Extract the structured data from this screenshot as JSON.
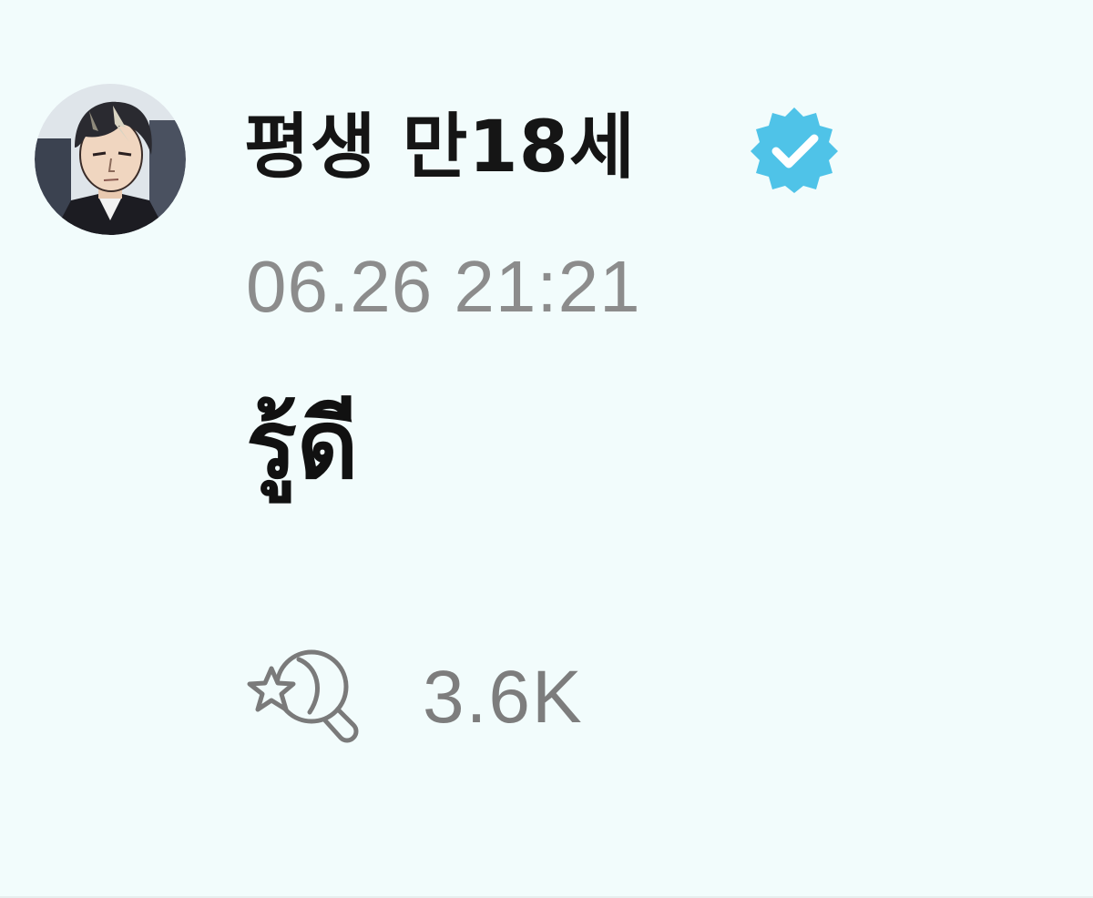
{
  "post": {
    "author": {
      "name": "평생 만18세",
      "verified": true,
      "verified_color": "#4fc3e8",
      "avatar_icon": "avatar-illustration"
    },
    "timestamp": "06.26 21:21",
    "message": "รู้ดี",
    "reaction": {
      "icon": "moon-star-lightstick-icon",
      "count": "3.6K"
    }
  },
  "colors": {
    "background": "#f2fcfc",
    "name_text": "#151515",
    "meta_text": "#8c8c8c"
  }
}
